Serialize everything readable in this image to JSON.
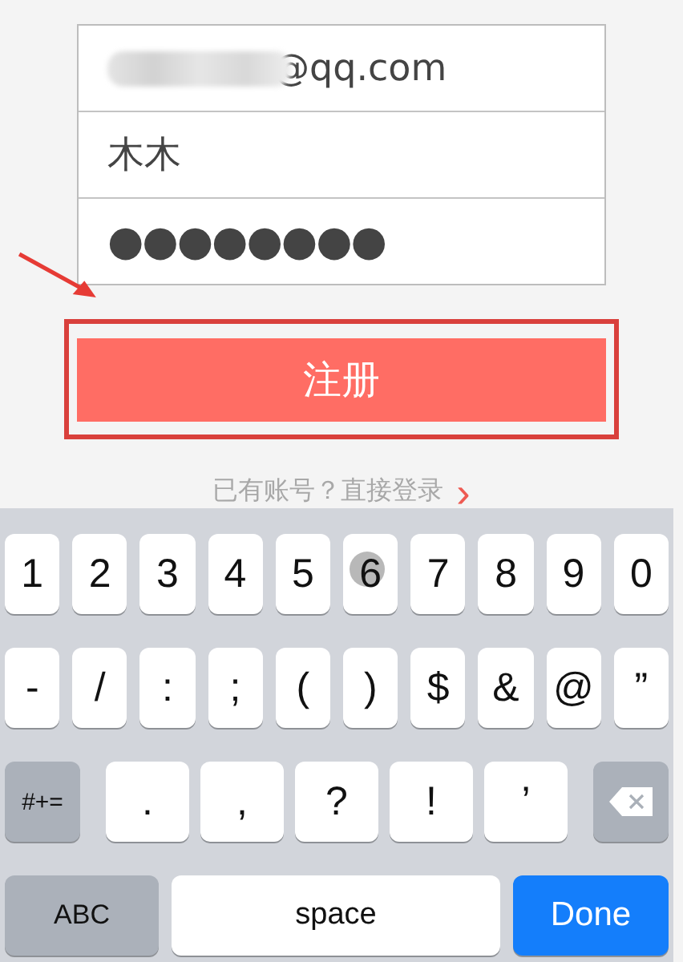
{
  "form": {
    "fields": [
      {
        "kind": "email",
        "value": "@qq.com",
        "redacted": true
      },
      {
        "kind": "text",
        "value": "木木",
        "redacted": false
      },
      {
        "kind": "password",
        "value": "●●●●●●●●",
        "redacted": false
      }
    ],
    "register_button": "注册",
    "login_link": {
      "text": "已有账号？直接登录",
      "chevron": "›"
    }
  },
  "keyboard": {
    "rows": [
      {
        "keys": [
          {
            "kind": "char",
            "label": "1",
            "pressed": false
          },
          {
            "kind": "char",
            "label": "2",
            "pressed": false
          },
          {
            "kind": "char",
            "label": "3",
            "pressed": false
          },
          {
            "kind": "char",
            "label": "4",
            "pressed": false
          },
          {
            "kind": "char",
            "label": "5",
            "pressed": false
          },
          {
            "kind": "char",
            "label": "6",
            "pressed": true
          },
          {
            "kind": "char",
            "label": "7",
            "pressed": false
          },
          {
            "kind": "char",
            "label": "8",
            "pressed": false
          },
          {
            "kind": "char",
            "label": "9",
            "pressed": false
          },
          {
            "kind": "char",
            "label": "0",
            "pressed": false
          }
        ]
      },
      {
        "keys": [
          {
            "kind": "char",
            "label": "-",
            "pressed": false
          },
          {
            "kind": "char",
            "label": "/",
            "pressed": false
          },
          {
            "kind": "char",
            "label": ":",
            "pressed": false
          },
          {
            "kind": "char",
            "label": ";",
            "pressed": false
          },
          {
            "kind": "char",
            "label": "(",
            "pressed": false
          },
          {
            "kind": "char",
            "label": ")",
            "pressed": false
          },
          {
            "kind": "char",
            "label": "$",
            "pressed": false
          },
          {
            "kind": "char",
            "label": "&",
            "pressed": false
          },
          {
            "kind": "char",
            "label": "@",
            "pressed": false
          },
          {
            "kind": "char",
            "label": "”",
            "pressed": false
          }
        ]
      },
      {
        "keys": [
          {
            "kind": "mode",
            "label": "#+=",
            "pressed": false
          },
          {
            "kind": "char",
            "label": ".",
            "pressed": false
          },
          {
            "kind": "char",
            "label": ",",
            "pressed": false
          },
          {
            "kind": "char",
            "label": "?",
            "pressed": false
          },
          {
            "kind": "char",
            "label": "!",
            "pressed": false
          },
          {
            "kind": "char",
            "label": "’",
            "pressed": false
          },
          {
            "kind": "delete",
            "pressed": false
          }
        ]
      },
      {
        "keys": [
          {
            "kind": "abc",
            "label": "ABC",
            "pressed": false
          },
          {
            "kind": "space",
            "label": "space",
            "pressed": false
          },
          {
            "kind": "done",
            "label": "Done",
            "pressed": false
          }
        ]
      }
    ]
  }
}
